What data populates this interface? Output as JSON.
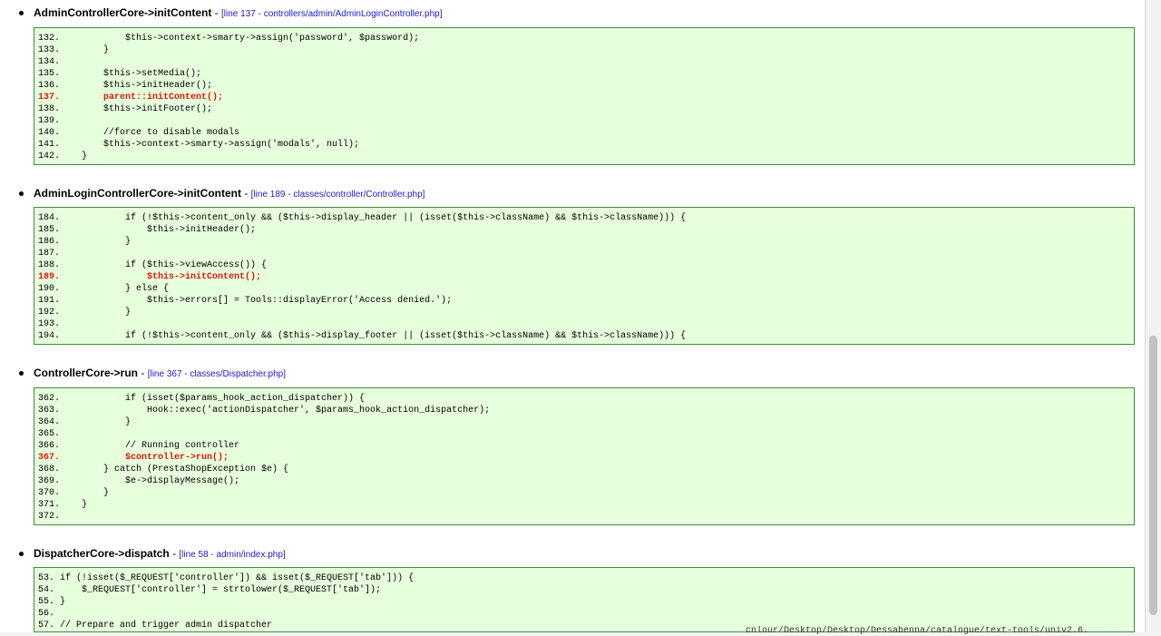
{
  "traces": [
    {
      "function": "AdminControllerCore->initContent",
      "separator": "-",
      "location": "[line 137 - controllers/admin/AdminLoginController.php]",
      "lines": [
        {
          "text": "132.            $this->context->smarty->assign('password', $password);",
          "error": false
        },
        {
          "text": "133.        }",
          "error": false
        },
        {
          "text": "134.",
          "error": false
        },
        {
          "text": "135.        $this->setMedia();",
          "error": false
        },
        {
          "text": "136.        $this->initHeader();",
          "error": false
        },
        {
          "text": "137.        parent::initContent();",
          "error": true
        },
        {
          "text": "138.        $this->initFooter();",
          "error": false
        },
        {
          "text": "139.",
          "error": false
        },
        {
          "text": "140.        //force to disable modals",
          "error": false
        },
        {
          "text": "141.        $this->context->smarty->assign('modals', null);",
          "error": false
        },
        {
          "text": "142.    }",
          "error": false
        }
      ]
    },
    {
      "function": "AdminLoginControllerCore->initContent",
      "separator": "-",
      "location": "[line 189 - classes/controller/Controller.php]",
      "lines": [
        {
          "text": "184.            if (!$this->content_only && ($this->display_header || (isset($this->className) && $this->className))) {",
          "error": false
        },
        {
          "text": "185.                $this->initHeader();",
          "error": false
        },
        {
          "text": "186.            }",
          "error": false
        },
        {
          "text": "187.",
          "error": false
        },
        {
          "text": "188.            if ($this->viewAccess()) {",
          "error": false
        },
        {
          "text": "189.                $this->initContent();",
          "error": true
        },
        {
          "text": "190.            } else {",
          "error": false
        },
        {
          "text": "191.                $this->errors[] = Tools::displayError('Access denied.');",
          "error": false
        },
        {
          "text": "192.            }",
          "error": false
        },
        {
          "text": "193.",
          "error": false
        },
        {
          "text": "194.            if (!$this->content_only && ($this->display_footer || (isset($this->className) && $this->className))) {",
          "error": false
        }
      ]
    },
    {
      "function": "ControllerCore->run",
      "separator": "-",
      "location": "[line 367 - classes/Dispatcher.php]",
      "lines": [
        {
          "text": "362.            if (isset($params_hook_action_dispatcher)) {",
          "error": false
        },
        {
          "text": "363.                Hook::exec('actionDispatcher', $params_hook_action_dispatcher);",
          "error": false
        },
        {
          "text": "364.            }",
          "error": false
        },
        {
          "text": "365.",
          "error": false
        },
        {
          "text": "366.            // Running controller",
          "error": false
        },
        {
          "text": "367.            $controller->run();",
          "error": true
        },
        {
          "text": "368.        } catch (PrestaShopException $e) {",
          "error": false
        },
        {
          "text": "369.            $e->displayMessage();",
          "error": false
        },
        {
          "text": "370.        }",
          "error": false
        },
        {
          "text": "371.    }",
          "error": false
        },
        {
          "text": "372.",
          "error": false
        }
      ]
    },
    {
      "function": "DispatcherCore->dispatch",
      "separator": "-",
      "location": "[line 58 - admin/index.php]",
      "lines": [
        {
          "text": "53. if (!isset($_REQUEST['controller']) && isset($_REQUEST['tab'])) {",
          "error": false
        },
        {
          "text": "54.     $_REQUEST['controller'] = strtolower($_REQUEST['tab']);",
          "error": false
        },
        {
          "text": "55. }",
          "error": false
        },
        {
          "text": "56.",
          "error": false
        },
        {
          "text": "57. // Prepare and trigger admin dispatcher",
          "error": false
        }
      ]
    }
  ],
  "background_terminal": {
    "text": "cnlour/Desktop/Desktop/Dessabenna/catalogue/text-tools/univ2.6."
  }
}
